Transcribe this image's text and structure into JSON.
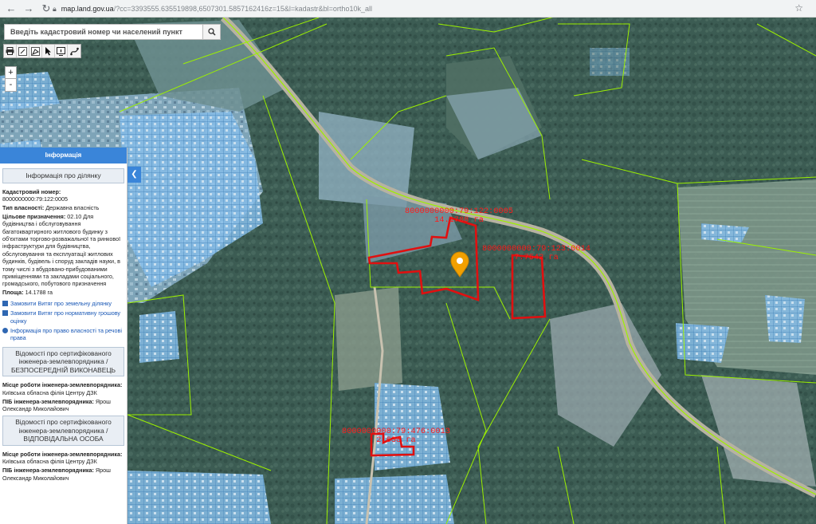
{
  "browser": {
    "url_host": "map.land.gov.ua",
    "url_rest": "/?cc=3393555.635519898,6507301.5857162416z=15&l=kadastr&bl=ortho10k_all"
  },
  "search": {
    "placeholder": "Введіть кадастровий номер чи населений пункт"
  },
  "toolbar": {
    "icons": [
      "print-icon",
      "measure-distance-icon",
      "measure-area-icon",
      "pointer-icon",
      "info-icon",
      "draw-icon"
    ]
  },
  "zoom": {
    "in": "+",
    "out": "-"
  },
  "panel": {
    "header": "Інформація",
    "section_title": "Інформація про ділянку",
    "cadastral_label": "Кадастровий номер:",
    "cadastral_value": "8000000000:79:122:0005",
    "ownership_label": "Тип власності:",
    "ownership_value": "Державна власність",
    "purpose_label": "Цільове призначення:",
    "purpose_value": "02.10 Для будівництва і обслуговування багатоквартирного житлового будинку з об'єктами торгово-розважальної та ринкової інфраструктури для будівництва, обслуговування та експлуатації житлових будинків, будівель і споруд закладів науки, в тому числі з вбудовано-прибудованими приміщеннями та закладами соціального, громадського, побутового призначення",
    "area_label": "Площа:",
    "area_value": "14.1788 га",
    "link_extract_land": "Замовити Витяг про земельну ділянку",
    "link_extract_valuation": "Замовити Витяг про нормативну грошову оцінку",
    "link_rights": "Інформація про право власності та речові права",
    "engineer_section_1": "Відомості про сертифікованого інженера-землевпорядника / БЕЗПОСЕРЕДНІЙ ВИКОНАВЕЦЬ",
    "workplace_label": "Місце роботи інженера-землевпорядника:",
    "workplace_value": "Київська обласна філія Центру ДЗК",
    "name_label": "ПІБ інженера-землевпорядника:",
    "name_value": "Ярош Олександр Миколайович",
    "engineer_section_2": "Відомості про сертифікованого інженера-землевпорядника / ВІДПОВІДАЛЬНА ОСОБА",
    "workplace_value_2": "Київська обласна філія Центру ДЗК",
    "name_value_2": "Ярош Олександр Миколайович"
  },
  "parcels": [
    {
      "id": "8000000000:79:122:0005",
      "area": "14.1788 га"
    },
    {
      "id": "8000000000:79:123:0014",
      "area": "7.7542 га"
    },
    {
      "id": "8000000000:79:476:0013",
      "area": "2.638 га"
    }
  ],
  "colors": {
    "parcel_outline": "#e01010",
    "label": "#ff1a1a",
    "cadastre_fill": "#7fb7e6",
    "boundary": "#9cf000",
    "marker": "#f2a000",
    "panel_header": "#3a85d9"
  }
}
